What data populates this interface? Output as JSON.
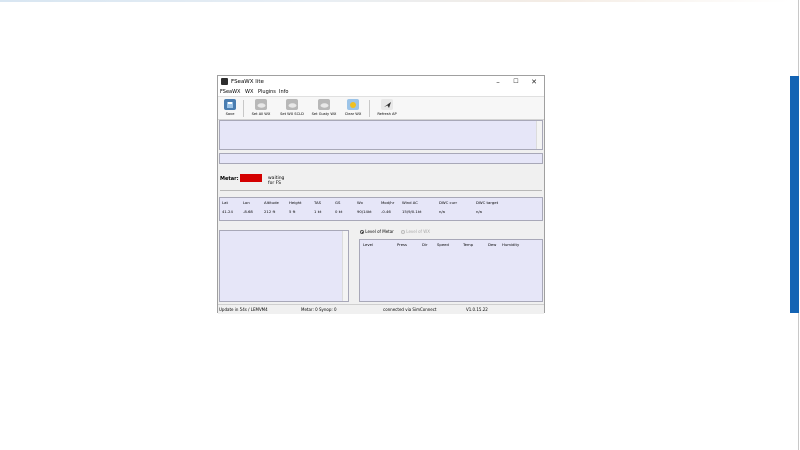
{
  "window": {
    "title": "FSeaWX lite",
    "buttons": {
      "minimize": "–",
      "maximize": "☐",
      "close": "✕"
    }
  },
  "menu": [
    "FSeaWX",
    "WX",
    "Plugins",
    "Info"
  ],
  "toolbar": [
    {
      "label": "Save",
      "icon": "save-icon",
      "color": "#4a7db0"
    },
    {
      "label": "Set All WX",
      "icon": "cloud-icon",
      "color": "#9a9a9a"
    },
    {
      "label": "Set WX SCLD",
      "icon": "cloud-icon",
      "color": "#9a9a9a"
    },
    {
      "label": "Set Gusty WX",
      "icon": "cloud-icon",
      "color": "#9a9a9a"
    },
    {
      "label": "Clear WX",
      "icon": "sun-icon",
      "color": "#e8b020"
    },
    {
      "label": "Refresh AP",
      "icon": "airplane-icon",
      "color": "#333333"
    }
  ],
  "metar": {
    "label": "Metar:",
    "badge": "",
    "status": "waiting for FS"
  },
  "grid": {
    "headers": [
      "Lat",
      "Lon",
      "Altitude",
      "Height",
      "TAS",
      "GS",
      "Wx",
      "Mod/hr",
      "Wind AC",
      "DWC curr",
      "DWC target"
    ],
    "values": [
      "41.24",
      "-8.68",
      "212 ft",
      "5 ft",
      "1 kt",
      "0 kt",
      "90/14kt",
      "-0.46",
      "15/9/0.1kt",
      "n/a",
      "n/a"
    ]
  },
  "radios": {
    "first": "Level of Metar",
    "second": "Level of WX"
  },
  "levels_table": {
    "headers": [
      "Level",
      "Press",
      "Dir",
      "Speed",
      "Temp",
      "Dew",
      "Humidity"
    ]
  },
  "statusbar": {
    "update": "Update in 54s / LEMVM4",
    "metar": "Metar: 0 Synop: 0",
    "connection": "connected via SimConnect",
    "version": "V1.0.15.22"
  }
}
